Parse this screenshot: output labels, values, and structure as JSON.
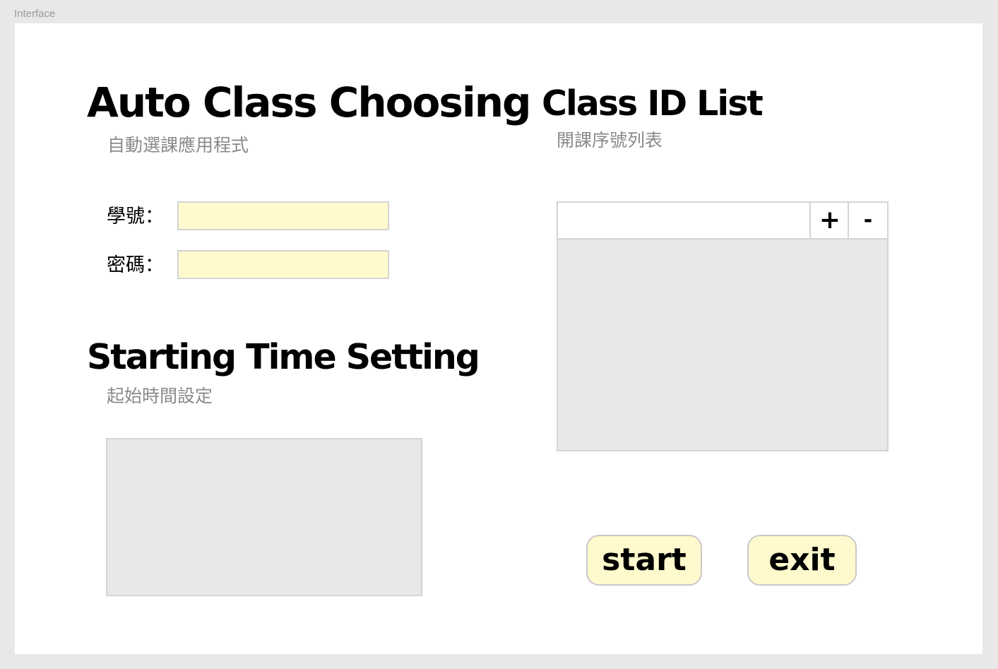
{
  "frame": {
    "label": "Interface"
  },
  "login": {
    "title": "Auto Class Choosing",
    "subtitle": "自動選課應用程式",
    "student_id_label": "學號：",
    "student_id_value": "",
    "password_label": "密碼：",
    "password_value": ""
  },
  "schedule": {
    "title": "Starting Time Setting",
    "subtitle": "起始時間設定"
  },
  "class_list": {
    "title": "Class ID List",
    "subtitle": "開課序號列表",
    "input_value": "",
    "add_label": "+",
    "remove_label": "-",
    "items": []
  },
  "actions": {
    "start_label": "start",
    "exit_label": "exit"
  },
  "colors": {
    "background": "#e8e8e8",
    "frame": "#ffffff",
    "input_fill": "#fffacd",
    "panel_fill": "#e8e8e8",
    "border": "#d4d4d4",
    "subtitle_text": "#8a8a8a"
  }
}
